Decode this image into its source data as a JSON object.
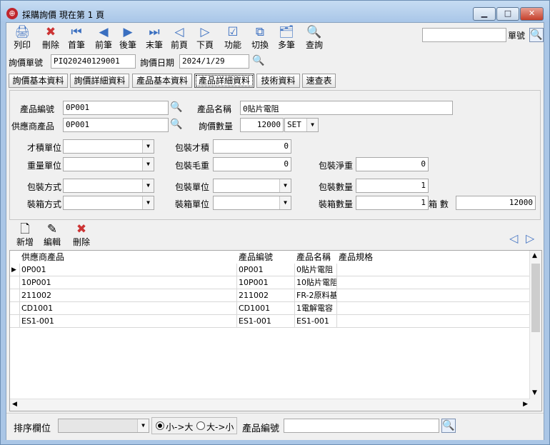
{
  "window": {
    "title": "採購詢價 現在第 1 頁",
    "controls": {
      "minimize": "▁",
      "maximize": "□",
      "close": "✕"
    }
  },
  "toolbar": {
    "buttons": [
      {
        "label": "列印",
        "icon": "print-icon",
        "glyph": "🖨"
      },
      {
        "label": "刪除",
        "icon": "delete-icon",
        "glyph": "✖"
      },
      {
        "label": "首筆",
        "icon": "first-record-icon",
        "glyph": "⏮"
      },
      {
        "label": "前筆",
        "icon": "prev-record-icon",
        "glyph": "◀"
      },
      {
        "label": "後筆",
        "icon": "next-record-icon",
        "glyph": "▶"
      },
      {
        "label": "末筆",
        "icon": "last-record-icon",
        "glyph": "⏭"
      },
      {
        "label": "前頁",
        "icon": "prev-page-icon",
        "glyph": "◁"
      },
      {
        "label": "下頁",
        "icon": "next-page-icon",
        "glyph": "▷"
      },
      {
        "label": "功能",
        "icon": "function-icon",
        "glyph": "☑"
      },
      {
        "label": "切換",
        "icon": "switch-icon",
        "glyph": "⧉"
      },
      {
        "label": "多筆",
        "icon": "multi-record-icon",
        "glyph": "🗂"
      },
      {
        "label": "查詢",
        "icon": "query-icon",
        "glyph": "🔍"
      }
    ],
    "doc_no_label": "單號",
    "doc_no_value": ""
  },
  "header": {
    "inquiry_no_label": "詢價單號",
    "inquiry_no_value": "PIQ20240129001",
    "inquiry_date_label": "詢價日期",
    "inquiry_date_value": "2024/1/29"
  },
  "tabs": [
    {
      "label": "詢價基本資料"
    },
    {
      "label": "詢價詳細資料"
    },
    {
      "label": "產品基本資料"
    },
    {
      "label": "產品詳細資料"
    },
    {
      "label": "技術資料"
    },
    {
      "label": "速查表"
    }
  ],
  "form": {
    "product_no_label": "產品編號",
    "product_no_value": "0P001",
    "product_name_label": "產品名稱",
    "product_name_value": "0貼片電阻",
    "supplier_product_label": "供應商產品",
    "supplier_product_value": "0P001",
    "inquiry_qty_label": "詢價數量",
    "inquiry_qty_value": "12000",
    "inquiry_qty_unit": "SET",
    "volume_unit_label": "才積單位",
    "volume_unit_value": "",
    "pack_volume_label": "包裝才積",
    "pack_volume_value": "0",
    "weight_unit_label": "重量單位",
    "weight_unit_value": "",
    "pack_gross_label": "包裝毛重",
    "pack_gross_value": "0",
    "pack_net_label": "包裝淨重",
    "pack_net_value": "0",
    "pack_method_label": "包裝方式",
    "pack_method_value": "",
    "pack_unit_label": "包裝單位",
    "pack_unit_value": "",
    "pack_qty_label": "包裝數量",
    "pack_qty_value": "1",
    "box_method_label": "裝箱方式",
    "box_method_value": "",
    "box_unit_label": "裝箱單位",
    "box_unit_value": "",
    "box_qty_label": "裝箱數量",
    "box_qty_value": "1",
    "box_count_label": "箱 數",
    "box_count_value": "12000"
  },
  "subtoolbar": {
    "add_label": "新增",
    "edit_label": "編輯",
    "delete_label": "刪除"
  },
  "grid": {
    "columns": [
      "供應商產品",
      "產品編號",
      "產品名稱",
      "產品規格"
    ],
    "rows": [
      [
        "0P001",
        "0P001",
        "0貼片電阻",
        ""
      ],
      [
        "10P001",
        "10P001",
        "10貼片電阻",
        ""
      ],
      [
        "211002",
        "211002",
        "FR-2原料基",
        ""
      ],
      [
        "CD1001",
        "CD1001",
        "1電解電容",
        ""
      ],
      [
        "ES1-001",
        "ES1-001",
        "ES1-001",
        ""
      ]
    ],
    "current_row_marker": "▶"
  },
  "statusbar": {
    "sort_label": "排序欄位",
    "sort_value": "",
    "asc_label": "小->大",
    "desc_label": "大->小",
    "search_label": "產品編號",
    "search_value": ""
  }
}
